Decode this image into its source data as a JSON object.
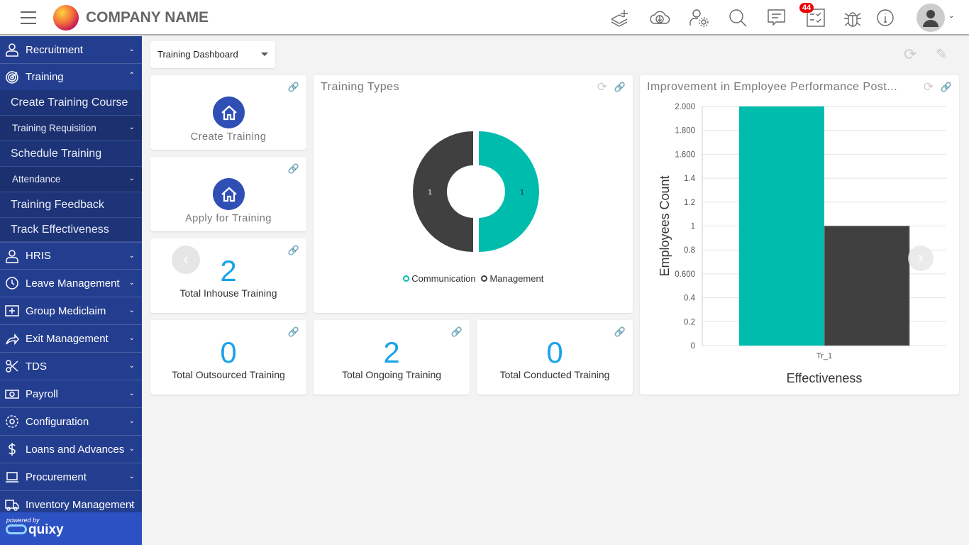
{
  "header": {
    "company": "COMPANY NAME",
    "badge_count": "44",
    "icons": [
      "layers-add-icon",
      "cloud-download-icon",
      "user-settings-icon",
      "search-icon",
      "chat-icon",
      "checklist-icon",
      "bug-icon",
      "info-icon"
    ]
  },
  "sidebar": {
    "items": [
      {
        "label": "Recruitment",
        "icon": "user-icon"
      },
      {
        "label": "Training",
        "icon": "target-icon",
        "expanded": true,
        "children": [
          {
            "label": "Create Training Course"
          },
          {
            "label": "Training Requisition",
            "dropdown": true
          },
          {
            "label": "Schedule Training"
          },
          {
            "label": "Attendance",
            "dropdown": true
          },
          {
            "label": "Training Feedback"
          },
          {
            "label": "Track Effectiveness"
          }
        ]
      },
      {
        "label": "HRIS",
        "icon": "user-icon"
      },
      {
        "label": "Leave Management",
        "icon": "clock-icon"
      },
      {
        "label": "Group Mediclaim",
        "icon": "medical-icon"
      },
      {
        "label": "Exit Management",
        "icon": "share-icon"
      },
      {
        "label": "TDS",
        "icon": "scissors-icon"
      },
      {
        "label": "Payroll",
        "icon": "money-icon"
      },
      {
        "label": "Configuration",
        "icon": "gear-icon"
      },
      {
        "label": "Loans and Advances",
        "icon": "dollar-icon"
      },
      {
        "label": "Procurement",
        "icon": "laptop-icon"
      },
      {
        "label": "Inventory Management",
        "icon": "truck-icon"
      }
    ],
    "powered_by": "powered by",
    "brand": "quixy"
  },
  "toolbar": {
    "dashboard_select": "Training Dashboard"
  },
  "cards": {
    "create_training": "Create Training",
    "apply_training": "Apply for Training",
    "inhouse": {
      "value": "2",
      "label": "Total Inhouse Training"
    },
    "outsourced": {
      "value": "0",
      "label": "Total Outsourced Training"
    },
    "ongoing": {
      "value": "2",
      "label": "Total Ongoing Training"
    },
    "conducted": {
      "value": "0",
      "label": "Total Conducted Training"
    }
  },
  "chart_data": [
    {
      "type": "pie",
      "title": "Training Types",
      "donut": true,
      "slices": [
        {
          "name": "Communication",
          "value": 1,
          "color": "#00bcad"
        },
        {
          "name": "Management",
          "value": 1,
          "color": "#404040"
        }
      ],
      "legend": "bottom"
    },
    {
      "type": "bar",
      "title": "Improvement in Employee Performance Post...",
      "xlabel": "Effectiveness",
      "ylabel": "Employees Count",
      "categories": [
        "Tr_1"
      ],
      "series": [
        {
          "values": [
            2
          ],
          "color": "#00bcad"
        },
        {
          "values": [
            1
          ],
          "color": "#404040"
        }
      ],
      "ylim": [
        0,
        2
      ],
      "ytick_labels": [
        "0",
        "0.2",
        "0.4",
        "0.600",
        "0.8",
        "1",
        "1.2",
        "1.4",
        "1.600",
        "1.800",
        "2.000"
      ],
      "grid": true
    }
  ]
}
